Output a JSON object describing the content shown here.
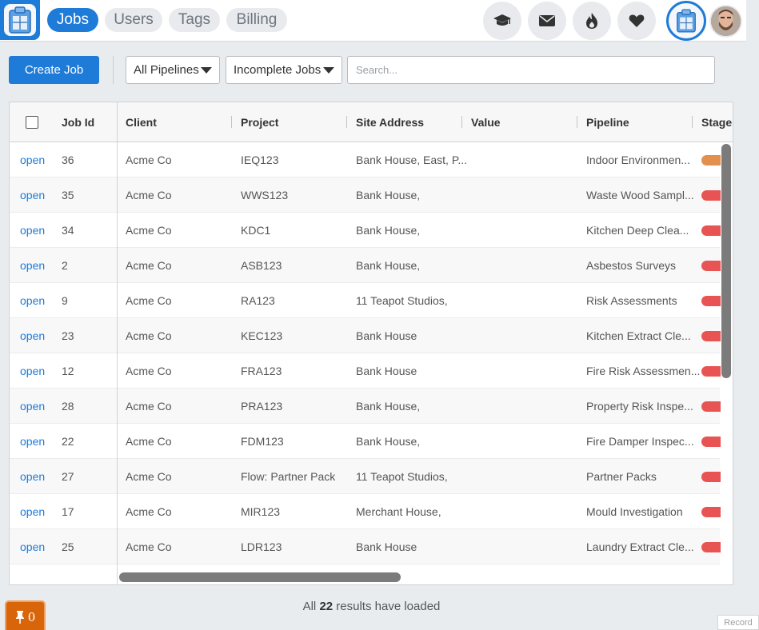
{
  "nav": {
    "tabs": [
      {
        "label": "Jobs",
        "active": true
      },
      {
        "label": "Users",
        "active": false
      },
      {
        "label": "Tags",
        "active": false
      },
      {
        "label": "Billing",
        "active": false
      }
    ],
    "icons": [
      "graduation-cap-icon",
      "envelope-icon",
      "fire-icon",
      "heart-icon"
    ]
  },
  "toolbar": {
    "create_label": "Create Job",
    "pipeline_filter": "All Pipelines",
    "status_filter": "Incomplete Jobs",
    "search_placeholder": "Search..."
  },
  "table": {
    "columns": [
      "Job Id",
      "Client",
      "Project",
      "Site Address",
      "Value",
      "Pipeline",
      "Stages"
    ],
    "rows": [
      {
        "action": "open",
        "id": "36",
        "client": "Acme Co",
        "project": "IEQ123",
        "address": "Bank House, East, P...",
        "value": "",
        "pipeline": "Indoor Environmen...",
        "stage_color": "#e38f4d"
      },
      {
        "action": "open",
        "id": "35",
        "client": "Acme Co",
        "project": "WWS123",
        "address": "Bank House,",
        "value": "",
        "pipeline": "Waste Wood Sampl...",
        "stage_color": "#e85454"
      },
      {
        "action": "open",
        "id": "34",
        "client": "Acme Co",
        "project": "KDC1",
        "address": "Bank House,",
        "value": "",
        "pipeline": "Kitchen Deep Clea...",
        "stage_color": "#e85454"
      },
      {
        "action": "open",
        "id": "2",
        "client": "Acme Co",
        "project": "ASB123",
        "address": "Bank House,",
        "value": "",
        "pipeline": "Asbestos Surveys",
        "stage_color": "#e85454"
      },
      {
        "action": "open",
        "id": "9",
        "client": "Acme Co",
        "project": "RA123",
        "address": "11 Teapot Studios,",
        "value": "",
        "pipeline": "Risk Assessments",
        "stage_color": "#e85454"
      },
      {
        "action": "open",
        "id": "23",
        "client": "Acme Co",
        "project": "KEC123",
        "address": "Bank House",
        "value": "",
        "pipeline": "Kitchen Extract Cle...",
        "stage_color": "#e85454"
      },
      {
        "action": "open",
        "id": "12",
        "client": "Acme Co",
        "project": "FRA123",
        "address": "Bank House",
        "value": "",
        "pipeline": "Fire Risk Assessmen...",
        "stage_color": "#e85454"
      },
      {
        "action": "open",
        "id": "28",
        "client": "Acme Co",
        "project": "PRA123",
        "address": "Bank House,",
        "value": "",
        "pipeline": "Property Risk Inspe...",
        "stage_color": "#e85454"
      },
      {
        "action": "open",
        "id": "22",
        "client": "Acme Co",
        "project": "FDM123",
        "address": "Bank House,",
        "value": "",
        "pipeline": "Fire Damper Inspec...",
        "stage_color": "#e85454"
      },
      {
        "action": "open",
        "id": "27",
        "client": "Acme Co",
        "project": "Flow: Partner Pack",
        "address": "11 Teapot Studios,",
        "value": "",
        "pipeline": "Partner Packs",
        "stage_color": "#e85454"
      },
      {
        "action": "open",
        "id": "17",
        "client": "Acme Co",
        "project": "MIR123",
        "address": "Merchant House,",
        "value": "",
        "pipeline": "Mould Investigation",
        "stage_color": "#e85454"
      },
      {
        "action": "open",
        "id": "25",
        "client": "Acme Co",
        "project": "LDR123",
        "address": "Bank House",
        "value": "",
        "pipeline": "Laundry Extract Cle...",
        "stage_color": "#e85454"
      }
    ]
  },
  "footer": {
    "status_prefix": "All",
    "result_count": "22",
    "status_suffix": "results have loaded",
    "pin_count": "0",
    "record_label": "Record"
  },
  "colors": {
    "accent": "#1e7bd8",
    "pin_badge": "#d9650a"
  }
}
